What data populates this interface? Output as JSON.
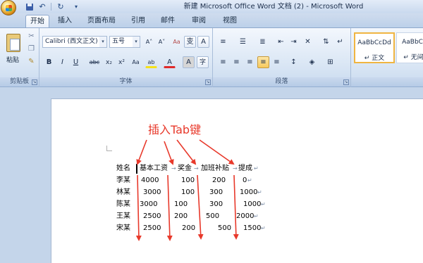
{
  "window": {
    "title": "新建 Microsoft Office Word 文档 (2) - Microsoft Word",
    "quick_access": {
      "save": "save-icon",
      "undo_glyph": "↶",
      "redo_glyph": "↻",
      "customize_glyph": "▾"
    }
  },
  "tabs": [
    {
      "label": "开始",
      "active": true
    },
    {
      "label": "插入"
    },
    {
      "label": "页面布局"
    },
    {
      "label": "引用"
    },
    {
      "label": "邮件"
    },
    {
      "label": "审阅"
    },
    {
      "label": "视图"
    }
  ],
  "ribbon": {
    "clipboard": {
      "label": "剪贴板",
      "paste": "粘贴",
      "cut_glyph": "✂",
      "copy_glyph": "❐",
      "format_painter_glyph": "✎"
    },
    "font": {
      "label": "字体",
      "font_name": "Calibri (西文正文)",
      "font_size": "五号",
      "grow": "A˄",
      "shrink": "A˅",
      "clear": "Aa",
      "phonetic": "变",
      "border_char": "A",
      "bold": "B",
      "italic": "I",
      "underline": "U",
      "strike": "abc",
      "subscript": "x₂",
      "superscript": "x²",
      "change_case": "Aa",
      "highlight": "ab",
      "font_color": "A",
      "char_shading": "A",
      "enclose": "字"
    },
    "paragraph": {
      "label": "段落"
    },
    "styles": {
      "items": [
        {
          "sample": "AaBbCcDd",
          "name": "↵ 正文",
          "selected": true
        },
        {
          "sample": "AaBbCcD",
          "name": "↵ 无间隔"
        }
      ]
    }
  },
  "document": {
    "annotation": "插入Tab键",
    "table": {
      "headers": [
        "姓名",
        "基本工资",
        "奖金",
        "加班补贴",
        "提成"
      ],
      "rows": [
        [
          "李某",
          "4000",
          "100",
          "200",
          "0"
        ],
        [
          "林某",
          "3000",
          "100",
          "300",
          "1000"
        ],
        [
          "陈某",
          "3000",
          "100",
          "300",
          "1000"
        ],
        [
          "王某",
          "2500",
          "200",
          "500",
          "2000"
        ],
        [
          "宋某",
          "2500",
          "200",
          "500",
          "1500"
        ]
      ]
    },
    "paragraph_mark": "↵",
    "tab_mark": "→",
    "annotation_color": "#e8392b"
  }
}
